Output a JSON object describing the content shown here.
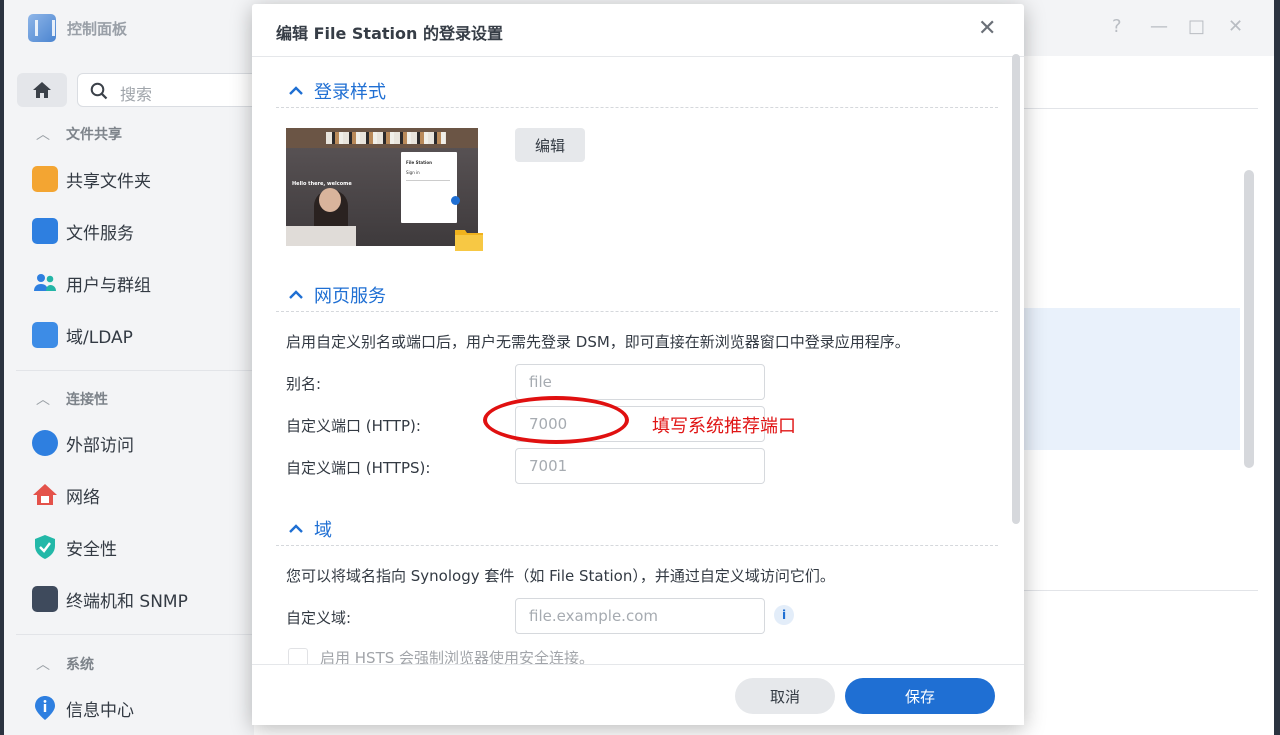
{
  "app": {
    "title": "控制面板"
  },
  "window_controls": {
    "help": "?",
    "minimize": "—",
    "maximize": "□",
    "close": "✕"
  },
  "sidebar": {
    "search_placeholder": "搜索",
    "sections": [
      {
        "label": "文件共享",
        "items": [
          {
            "label": "共享文件夹",
            "icon": "shared-folder-icon"
          },
          {
            "label": "文件服务",
            "icon": "file-services-icon"
          },
          {
            "label": "用户与群组",
            "icon": "users-icon"
          },
          {
            "label": "域/LDAP",
            "icon": "domain-ldap-icon"
          }
        ]
      },
      {
        "label": "连接性",
        "items": [
          {
            "label": "外部访问",
            "icon": "external-access-icon"
          },
          {
            "label": "网络",
            "icon": "network-icon"
          },
          {
            "label": "安全性",
            "icon": "shield-icon"
          },
          {
            "label": "终端机和 SNMP",
            "icon": "terminal-icon"
          }
        ]
      },
      {
        "label": "系统",
        "items": [
          {
            "label": "信息中心",
            "icon": "info-center-icon"
          }
        ]
      }
    ]
  },
  "dialog": {
    "title": "编辑 File Station 的登录设置",
    "close": "✕",
    "login_style": {
      "header": "登录样式",
      "edit_button": "编辑",
      "preview": {
        "greeting": "Hello there, welcome",
        "card_title": "File Station",
        "card_signin": "Sign in"
      }
    },
    "web_service": {
      "header": "网页服务",
      "description": "启用自定义别名或端口后，用户无需先登录 DSM，即可直接在新浏览器窗口中登录应用程序。",
      "alias": {
        "label": "别名:",
        "placeholder": "file"
      },
      "http_port": {
        "label": "自定义端口 (HTTP):",
        "placeholder": "7000"
      },
      "https_port": {
        "label": "自定义端口 (HTTPS):",
        "placeholder": "7001"
      }
    },
    "annotation": "填写系统推荐端口",
    "domain": {
      "header": "域",
      "description": "您可以将域名指向 Synology 套件（如 File Station），并通过自定义域访问它们。",
      "custom_domain": {
        "label": "自定义域:",
        "placeholder": "file.example.com"
      },
      "info": "i",
      "hsts_label": "启用 HSTS 会强制浏览器使用安全连接。"
    },
    "footer": {
      "cancel": "取消",
      "save": "保存"
    }
  },
  "colors": {
    "accent": "#1f6fd3",
    "annotation": "#e01515"
  }
}
